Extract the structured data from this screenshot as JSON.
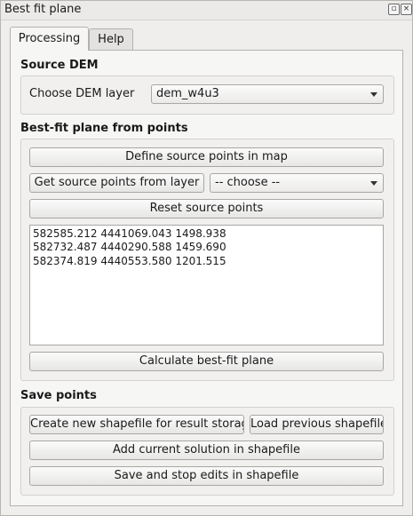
{
  "window": {
    "title": "Best fit plane"
  },
  "tabs": [
    {
      "label": "Processing",
      "active": true
    },
    {
      "label": "Help",
      "active": false
    }
  ],
  "source_dem": {
    "title": "Source DEM",
    "choose_label": "Choose DEM layer",
    "selected_layer": "dem_w4u3"
  },
  "bestfit": {
    "title": "Best-fit plane from points",
    "define_button": "Define source points in map",
    "get_button": "Get source points from layer",
    "layer_select": "--  choose  --",
    "reset_button": "Reset source points",
    "points": [
      "582585.212 4441069.043 1498.938",
      "582732.487 4440290.588 1459.690",
      "582374.819 4440553.580 1201.515"
    ],
    "calculate_button": "Calculate best-fit plane"
  },
  "save_points": {
    "title": "Save points",
    "create_button": "Create new shapefile for result storage",
    "load_button": "Load previous shapefile",
    "add_button": "Add current solution in shapefile",
    "save_button": "Save and stop edits in shapefile"
  }
}
